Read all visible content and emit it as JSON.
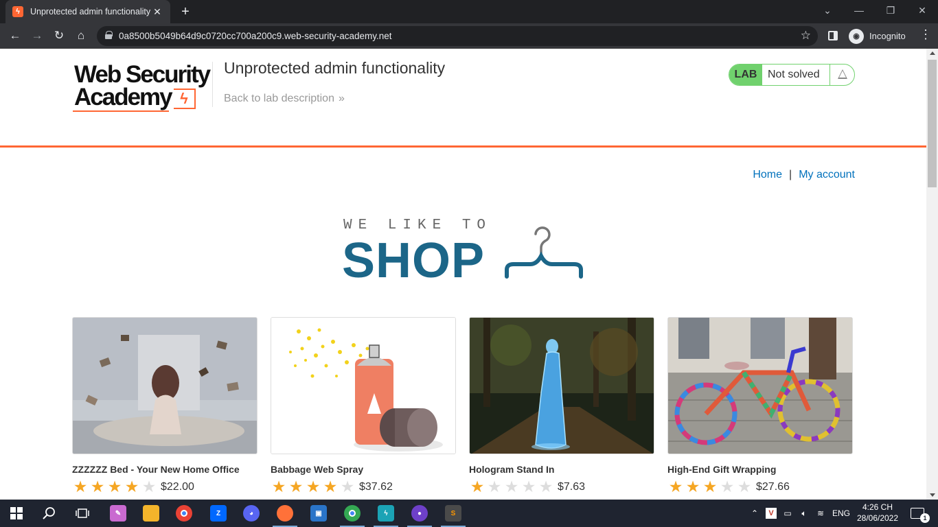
{
  "browser": {
    "tab_title": "Unprotected admin functionality",
    "new_tab_symbol": "+",
    "url": "0a8500b5049b64d9c0720cc700a200c9.web-security-academy.net",
    "profile_label": "Incognito"
  },
  "header": {
    "logo_line1": "Web Security",
    "logo_line2": "Academy",
    "lab_title": "Unprotected admin functionality",
    "back_link": "Back to lab description",
    "back_arrows": "»",
    "lab_badge_label": "LAB",
    "lab_status": "Not solved"
  },
  "nav": {
    "home": "Home",
    "separator": "|",
    "my_account": "My account"
  },
  "hero": {
    "subtitle": "WE LIKE TO",
    "title": "SHOP"
  },
  "products": [
    {
      "name": "ZZZZZZ Bed - Your New Home Office",
      "price": "$22.00",
      "rating": 4
    },
    {
      "name": "Babbage Web Spray",
      "price": "$37.62",
      "rating": 4
    },
    {
      "name": "Hologram Stand In",
      "price": "$7.63",
      "rating": 1
    },
    {
      "name": "High-End Gift Wrapping",
      "price": "$27.66",
      "rating": 3
    }
  ],
  "taskbar": {
    "language": "ENG",
    "time": "4:26 CH",
    "date": "28/06/2022",
    "notification_count": "1"
  },
  "colors": {
    "accent_orange": "#ff6633",
    "link_blue": "#0071bc",
    "lab_green": "#70d16d",
    "shop_blue": "#1c6688",
    "star_gold": "#f5a623"
  }
}
